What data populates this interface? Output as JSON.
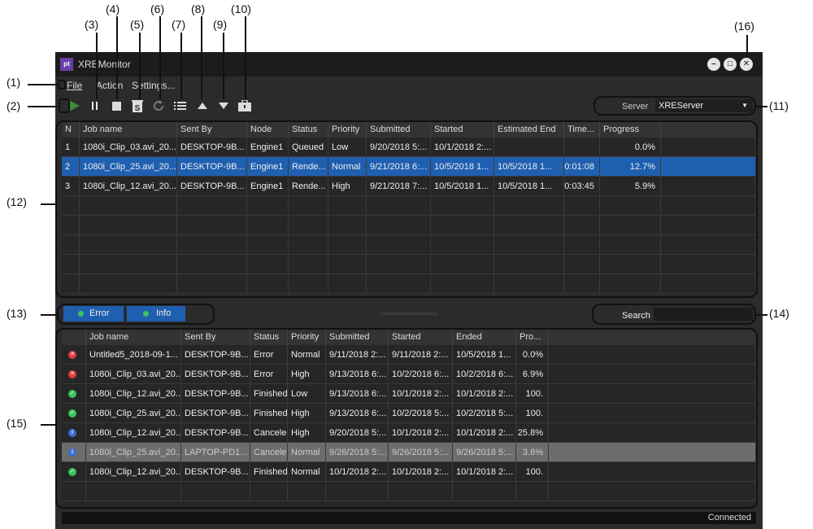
{
  "annotations": {
    "n1": "(1)",
    "n2": "(2)",
    "n3": "(3)",
    "n4": "(4)",
    "n5": "(5)",
    "n6": "(6)",
    "n7": "(7)",
    "n8": "(8)",
    "n9": "(9)",
    "n10": "(10)",
    "n11": "(11)",
    "n12": "(12)",
    "n13": "(13)",
    "n14": "(14)",
    "n15": "(15)",
    "n16": "(16)"
  },
  "window": {
    "title": "XREMonitor",
    "logo": "pt"
  },
  "menu": {
    "file": "File",
    "action": "Action",
    "settings": "Settings..."
  },
  "toolbar": {
    "icons": [
      "play-icon",
      "pause-icon",
      "stop-icon",
      "delete-job-icon",
      "refresh-icon",
      "list-icon",
      "move-up-icon",
      "move-down-icon",
      "toolbox-icon"
    ],
    "server_label": "Server",
    "server_value": "XREServer"
  },
  "jobs": {
    "columns": [
      "N",
      "Job name",
      "Sent By",
      "Node",
      "Status",
      "Priority",
      "Submitted",
      "Started",
      "Estimated End",
      "Time...",
      "Progress"
    ],
    "rows": [
      {
        "n": "1",
        "job": "1080i_Clip_03.avi_20...",
        "sent": "DESKTOP-9B...",
        "node": "Engine1",
        "status": "Queued",
        "priority": "Low",
        "submitted": "9/20/2018 5:...",
        "started": "10/1/2018 2:...",
        "est_end": "",
        "time": "",
        "progress": "0.0%"
      },
      {
        "n": "2",
        "job": "1080i_Clip_25.avi_20...",
        "sent": "DESKTOP-9B...",
        "node": "Engine1",
        "status": "Rende...",
        "priority": "Normal",
        "submitted": "9/21/2018 6:...",
        "started": "10/5/2018 1...",
        "est_end": "10/5/2018 1...",
        "time": "0:01:08",
        "progress": "12.7%"
      },
      {
        "n": "3",
        "job": "1080i_Clip_12.avi_20...",
        "sent": "DESKTOP-9B...",
        "node": "Engine1",
        "status": "Rende...",
        "priority": "High",
        "submitted": "9/21/2018 7:...",
        "started": "10/5/2018 1...",
        "est_end": "10/5/2018 1...",
        "time": "0:03:45",
        "progress": "5.9%"
      }
    ],
    "selected_row": 2
  },
  "filters": {
    "error": "Error",
    "info": "Info",
    "search_label": "Search",
    "search_value": ""
  },
  "log": {
    "columns": [
      "",
      "Job name",
      "Sent By",
      "Status",
      "Priority",
      "Submitted",
      "Started",
      "Ended",
      "Pro..."
    ],
    "rows": [
      {
        "icon": "error-icon",
        "job": "Untitled5_2018-09-1...",
        "sent": "DESKTOP-9B...",
        "status": "Error",
        "priority": "Normal",
        "submitted": "9/11/2018 2:...",
        "started": "9/11/2018 2:...",
        "ended": "10/5/2018 1...",
        "progress": "0.0%"
      },
      {
        "icon": "error-icon",
        "job": "1080i_Clip_03.avi_20...",
        "sent": "DESKTOP-9B...",
        "status": "Error",
        "priority": "High",
        "submitted": "9/13/2018 6:...",
        "started": "10/2/2018 6:...",
        "ended": "10/2/2018 6:...",
        "progress": "6.9%"
      },
      {
        "icon": "success-icon",
        "job": "1080i_Clip_12.avi_20...",
        "sent": "DESKTOP-9B...",
        "status": "Finished",
        "priority": "Low",
        "submitted": "9/13/2018 6:...",
        "started": "10/1/2018 2:...",
        "ended": "10/1/2018 2:...",
        "progress": "100."
      },
      {
        "icon": "success-icon",
        "job": "1080i_Clip_25.avi_20...",
        "sent": "DESKTOP-9B...",
        "status": "Finished",
        "priority": "High",
        "submitted": "9/13/2018 6:...",
        "started": "10/2/2018 5:...",
        "ended": "10/2/2018 5:...",
        "progress": "100."
      },
      {
        "icon": "info-icon",
        "job": "1080i_Clip_12.avi_20...",
        "sent": "DESKTOP-9B...",
        "status": "Canceled",
        "priority": "High",
        "submitted": "9/20/2018 5:...",
        "started": "10/1/2018 2:...",
        "ended": "10/1/2018 2:...",
        "progress": "25.8%"
      },
      {
        "icon": "info-icon",
        "job": "1080i_Clip_25.avi_20...",
        "sent": "LAPTOP-PD1...",
        "status": "Canceled",
        "priority": "Normal",
        "submitted": "9/26/2018 5:...",
        "started": "9/26/2018 5:...",
        "ended": "9/26/2018 5:...",
        "progress": "3.6%"
      },
      {
        "icon": "success-icon",
        "job": "1080i_Clip_12.avi_20...",
        "sent": "DESKTOP-9B...",
        "status": "Finished",
        "priority": "Normal",
        "submitted": "10/1/2018 2:...",
        "started": "10/1/2018 2:...",
        "ended": "10/1/2018 2:...",
        "progress": "100."
      }
    ],
    "highlighted_row": 6
  },
  "status": {
    "connection": "Connected"
  },
  "colors": {
    "accent": "#1f5fb0",
    "play": "#3d8a3d",
    "error": "#e03c3c",
    "success": "#39c35a",
    "info": "#3d6fd6"
  }
}
